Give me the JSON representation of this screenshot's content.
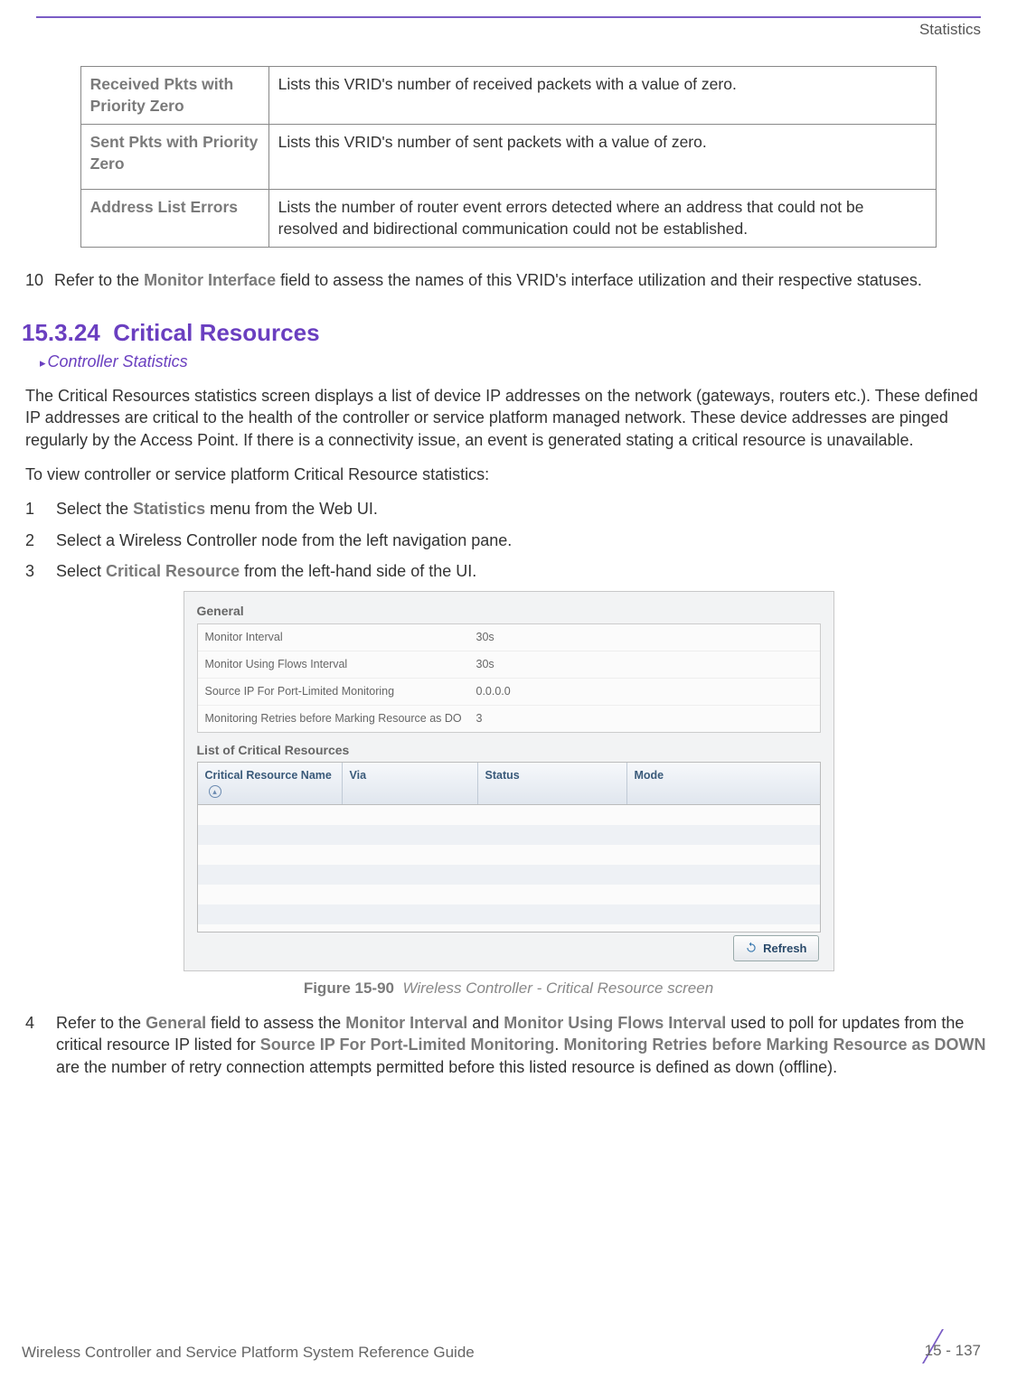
{
  "header": {
    "section": "Statistics"
  },
  "table": {
    "rows": [
      {
        "term": "Received Pkts with Priority Zero",
        "desc": "Lists this VRID's number of received packets with a value of zero."
      },
      {
        "term": "Sent Pkts with Priority Zero",
        "desc": "Lists this VRID's number of sent packets with a value of zero."
      },
      {
        "term": "Address List Errors",
        "desc": "Lists the number of router event errors detected where an address that could not be resolved and bidirectional communication could not be established."
      }
    ]
  },
  "step10": {
    "num": "10",
    "pre": "Refer to the ",
    "bold": "Monitor Interface",
    "post": " field to assess the names of this VRID's interface utilization and their respective statuses."
  },
  "section": {
    "number": "15.3.24",
    "title": "Critical Resources",
    "breadcrumb": "Controller Statistics"
  },
  "intro": "The Critical Resources statistics screen displays a list of device IP addresses on the network (gateways, routers etc.). These defined IP addresses are critical to the health of the controller or service platform managed network. These device addresses are pinged regularly by the Access Point. If there is a connectivity issue, an event is generated stating a critical resource is unavailable.",
  "lead": "To view controller or service platform Critical Resource statistics:",
  "steps": {
    "s1": {
      "pre": "Select the ",
      "bold": "Statistics",
      "post": " menu from the Web UI."
    },
    "s2": {
      "text": "Select a Wireless Controller node from the left navigation pane."
    },
    "s3": {
      "pre": "Select ",
      "bold": "Critical Resource",
      "post": " from the left-hand side of the UI."
    }
  },
  "screenshot": {
    "generalLegend": "General",
    "kv": [
      {
        "k": "Monitor Interval",
        "v": "30s"
      },
      {
        "k": "Monitor Using Flows Interval",
        "v": "30s"
      },
      {
        "k": "Source IP For Port-Limited Monitoring",
        "v": "0.0.0.0"
      },
      {
        "k": "Monitoring Retries before Marking Resource as DO",
        "v": "3"
      }
    ],
    "listLegend": "List of Critical Resources",
    "cols": {
      "c1": "Critical Resource Name",
      "c2": "Via",
      "c3": "Status",
      "c4": "Mode"
    },
    "refresh": "Refresh"
  },
  "figure": {
    "num": "Figure 15-90",
    "title": "Wireless Controller - Critical Resource screen"
  },
  "step4": {
    "num": "4",
    "p1": "Refer to the ",
    "b1": "General",
    "p2": " field to assess the ",
    "b2": "Monitor Interval",
    "p3": " and ",
    "b3": "Monitor Using Flows Interval",
    "p4": " used to poll for updates from the critical resource IP listed for ",
    "b4": "Source IP For Port-Limited Monitoring",
    "p5": ". ",
    "b5": "Monitoring Retries before Marking Resource as DOWN",
    "p6": " are the number of retry connection attempts permitted before this listed resource is defined as down (offline)."
  },
  "footer": {
    "doc": "Wireless Controller and Service Platform System Reference Guide",
    "page": "15 - 137"
  }
}
